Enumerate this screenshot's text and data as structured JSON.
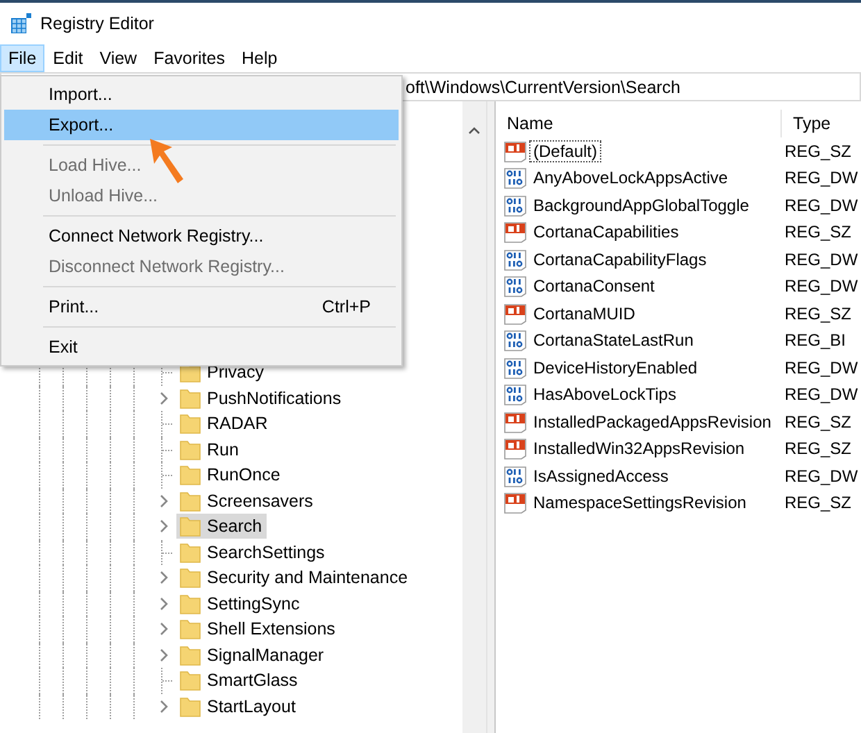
{
  "window": {
    "title": "Registry Editor"
  },
  "menubar": [
    {
      "label": "File",
      "selected": true
    },
    {
      "label": "Edit",
      "selected": false
    },
    {
      "label": "View",
      "selected": false
    },
    {
      "label": "Favorites",
      "selected": false
    },
    {
      "label": "Help",
      "selected": false
    }
  ],
  "file_menu": [
    {
      "kind": "item",
      "label": "Import...",
      "disabled": false,
      "selected": false
    },
    {
      "kind": "item",
      "label": "Export...",
      "disabled": false,
      "selected": true
    },
    {
      "kind": "separator"
    },
    {
      "kind": "item",
      "label": "Load Hive...",
      "disabled": true,
      "selected": false
    },
    {
      "kind": "item",
      "label": "Unload Hive...",
      "disabled": true,
      "selected": false
    },
    {
      "kind": "separator"
    },
    {
      "kind": "item",
      "label": "Connect Network Registry...",
      "disabled": false,
      "selected": false
    },
    {
      "kind": "item",
      "label": "Disconnect Network Registry...",
      "disabled": true,
      "selected": false
    },
    {
      "kind": "separator"
    },
    {
      "kind": "item",
      "label": "Print...",
      "shortcut": "Ctrl+P",
      "disabled": false,
      "selected": false
    },
    {
      "kind": "separator"
    },
    {
      "kind": "item",
      "label": "Exit",
      "disabled": false,
      "selected": false
    }
  ],
  "address_bar": {
    "value": "oft\\Windows\\CurrentVersion\\Search"
  },
  "tree": [
    {
      "label": "Privacy",
      "expandable": false,
      "selected": false
    },
    {
      "label": "PushNotifications",
      "expandable": true,
      "selected": false
    },
    {
      "label": "RADAR",
      "expandable": false,
      "selected": false
    },
    {
      "label": "Run",
      "expandable": false,
      "selected": false
    },
    {
      "label": "RunOnce",
      "expandable": false,
      "selected": false
    },
    {
      "label": "Screensavers",
      "expandable": true,
      "selected": false
    },
    {
      "label": "Search",
      "expandable": true,
      "selected": true
    },
    {
      "label": "SearchSettings",
      "expandable": false,
      "selected": false
    },
    {
      "label": "Security and Maintenance",
      "expandable": true,
      "selected": false
    },
    {
      "label": "SettingSync",
      "expandable": true,
      "selected": false
    },
    {
      "label": "Shell Extensions",
      "expandable": true,
      "selected": false
    },
    {
      "label": "SignalManager",
      "expandable": true,
      "selected": false
    },
    {
      "label": "SmartGlass",
      "expandable": false,
      "selected": false
    },
    {
      "label": "StartLayout",
      "expandable": true,
      "selected": false
    }
  ],
  "values_table": {
    "columns": [
      "Name",
      "Type"
    ],
    "rows": [
      {
        "kind": "string",
        "name": "(Default)",
        "type": "REG_SZ",
        "focused": true
      },
      {
        "kind": "binary",
        "name": "AnyAboveLockAppsActive",
        "type": "REG_DW",
        "focused": false
      },
      {
        "kind": "binary",
        "name": "BackgroundAppGlobalToggle",
        "type": "REG_DW",
        "focused": false
      },
      {
        "kind": "string",
        "name": "CortanaCapabilities",
        "type": "REG_SZ",
        "focused": false
      },
      {
        "kind": "binary",
        "name": "CortanaCapabilityFlags",
        "type": "REG_DW",
        "focused": false
      },
      {
        "kind": "binary",
        "name": "CortanaConsent",
        "type": "REG_DW",
        "focused": false
      },
      {
        "kind": "string",
        "name": "CortanaMUID",
        "type": "REG_SZ",
        "focused": false
      },
      {
        "kind": "binary",
        "name": "CortanaStateLastRun",
        "type": "REG_BI",
        "focused": false
      },
      {
        "kind": "binary",
        "name": "DeviceHistoryEnabled",
        "type": "REG_DW",
        "focused": false
      },
      {
        "kind": "binary",
        "name": "HasAboveLockTips",
        "type": "REG_DW",
        "focused": false
      },
      {
        "kind": "string",
        "name": "InstalledPackagedAppsRevision",
        "type": "REG_SZ",
        "focused": false
      },
      {
        "kind": "string",
        "name": "InstalledWin32AppsRevision",
        "type": "REG_SZ",
        "focused": false
      },
      {
        "kind": "binary",
        "name": "IsAssignedAccess",
        "type": "REG_DW",
        "focused": false
      },
      {
        "kind": "string",
        "name": "NamespaceSettingsRevision",
        "type": "REG_SZ",
        "focused": false
      }
    ]
  }
}
